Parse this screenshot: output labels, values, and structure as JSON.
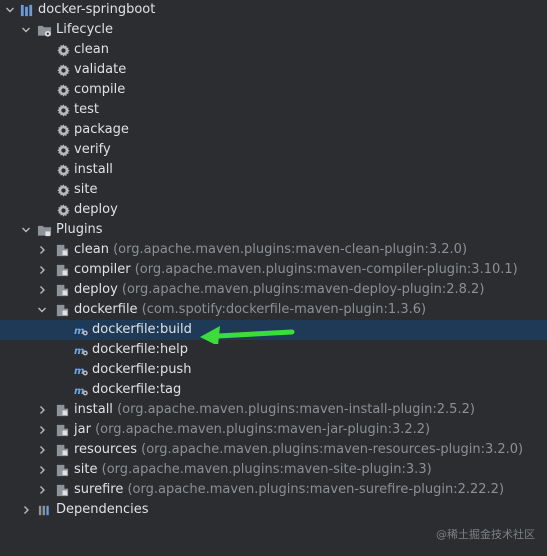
{
  "project": {
    "name": "docker-springboot"
  },
  "lifecycle": {
    "label": "Lifecycle",
    "phases": [
      "clean",
      "validate",
      "compile",
      "test",
      "package",
      "verify",
      "install",
      "site",
      "deploy"
    ]
  },
  "plugins": {
    "label": "Plugins",
    "items": [
      {
        "name": "clean",
        "artifact": "(org.apache.maven.plugins:maven-clean-plugin:3.2.0)"
      },
      {
        "name": "compiler",
        "artifact": "(org.apache.maven.plugins:maven-compiler-plugin:3.10.1)"
      },
      {
        "name": "deploy",
        "artifact": "(org.apache.maven.plugins:maven-deploy-plugin:2.8.2)"
      },
      {
        "name": "dockerfile",
        "artifact": "(com.spotify:dockerfile-maven-plugin:1.3.6)"
      },
      {
        "name": "install",
        "artifact": "(org.apache.maven.plugins:maven-install-plugin:2.5.2)"
      },
      {
        "name": "jar",
        "artifact": "(org.apache.maven.plugins:maven-jar-plugin:3.2.2)"
      },
      {
        "name": "resources",
        "artifact": "(org.apache.maven.plugins:maven-resources-plugin:3.2.0)"
      },
      {
        "name": "site",
        "artifact": "(org.apache.maven.plugins:maven-site-plugin:3.3)"
      },
      {
        "name": "surefire",
        "artifact": "(org.apache.maven.plugins:maven-surefire-plugin:2.22.2)"
      }
    ],
    "dockerfile_goals": [
      "dockerfile:build",
      "dockerfile:help",
      "dockerfile:push",
      "dockerfile:tag"
    ],
    "selected_goal": "dockerfile:build"
  },
  "dependencies": {
    "label": "Dependencies"
  },
  "watermark": "@稀土掘金技术社区",
  "colors": {
    "selection": "#1e3a56",
    "arrow": "#3ddc3d",
    "background": "#2b2d30"
  }
}
